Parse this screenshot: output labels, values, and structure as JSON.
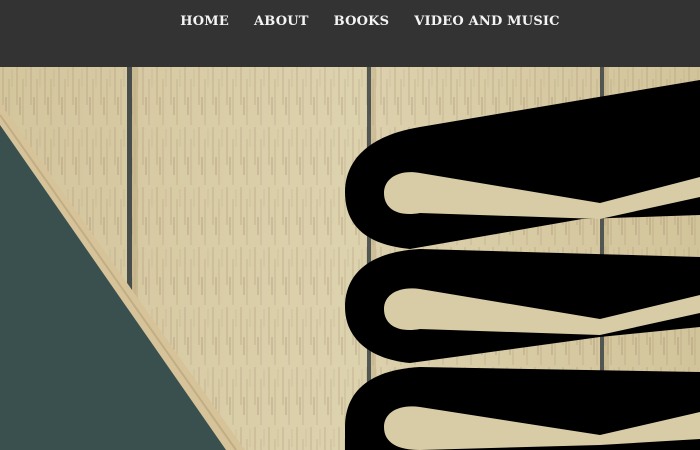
{
  "nav": {
    "items": [
      {
        "label": "HOME"
      },
      {
        "label": "ABOUT"
      },
      {
        "label": "BOOKS"
      },
      {
        "label": "VIDEO AND MUSIC"
      }
    ]
  },
  "hero": {
    "background": "wood-plank-texture",
    "left_object": "green-hardcover-book",
    "right_icon": "book-stack-icon"
  },
  "colors": {
    "header_bg": "#333333",
    "nav_text": "#f4f4f4",
    "wood_light": "#d8cca6",
    "wood_grain": "#8b6a55",
    "plank_gap": "#2f3a3c",
    "book_cover": "#3d5453",
    "book_page_edge": "#d6c39a",
    "icon_fill": "#000000"
  }
}
